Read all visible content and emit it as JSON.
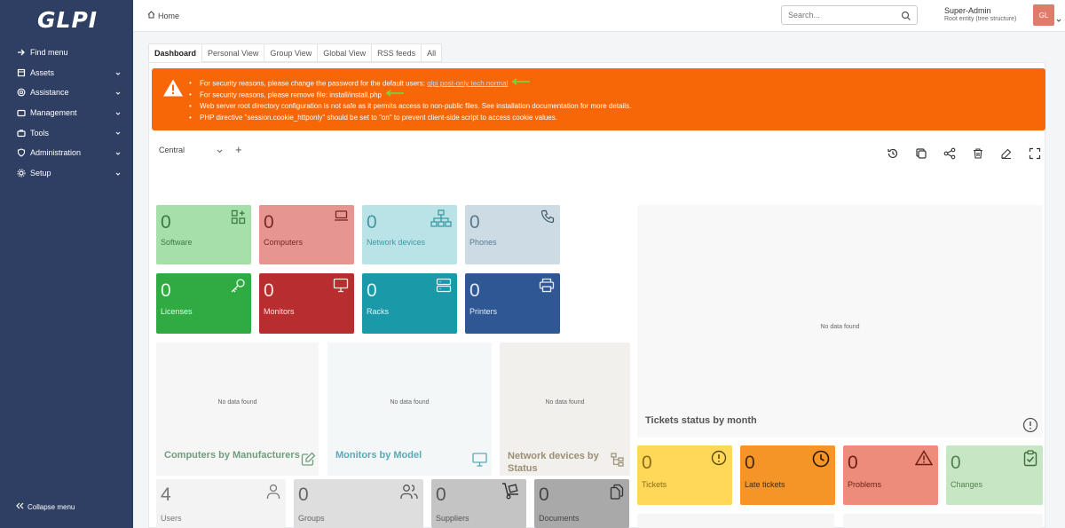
{
  "sidebar": {
    "logo": "GLPI",
    "items": [
      {
        "label": "Find menu",
        "has_chevron": false
      },
      {
        "label": "Assets",
        "has_chevron": true
      },
      {
        "label": "Assistance",
        "has_chevron": true
      },
      {
        "label": "Management",
        "has_chevron": true
      },
      {
        "label": "Tools",
        "has_chevron": true
      },
      {
        "label": "Administration",
        "has_chevron": true
      },
      {
        "label": "Setup",
        "has_chevron": true
      }
    ],
    "collapse_label": "Collapse menu"
  },
  "header": {
    "breadcrumb": "Home",
    "search_placeholder": "Search...",
    "user_name": "Super-Admin",
    "user_entity": "Root entity (tree structure)",
    "avatar_initials": "GL"
  },
  "tabs": [
    "Dashboard",
    "Personal View",
    "Group View",
    "Global View",
    "RSS feeds",
    "All"
  ],
  "active_tab": "Dashboard",
  "alert": {
    "line1_prefix": "For security reasons, please change the password for the default users:",
    "line1_users": "glpi post-only tech normal",
    "line2": "For security reasons, please remove file: install/install.php",
    "line3": "Web server root directory configuration is not safe as it permits access to non-public files. See installation documentation for more details.",
    "line4": "PHP directive \"session.cookie_httponly\" should be set to \"on\" to prevent client-side script to access cookie values."
  },
  "dashboard": {
    "selected": "Central",
    "add_symbol": "+"
  },
  "cards": {
    "software": {
      "value": "0",
      "label": "Software"
    },
    "computers": {
      "value": "0",
      "label": "Computers"
    },
    "network_devices": {
      "value": "0",
      "label": "Network devices"
    },
    "phones": {
      "value": "0",
      "label": "Phones"
    },
    "licenses": {
      "value": "0",
      "label": "Licenses"
    },
    "monitors": {
      "value": "0",
      "label": "Monitors"
    },
    "racks": {
      "value": "0",
      "label": "Racks"
    },
    "printers": {
      "value": "0",
      "label": "Printers"
    },
    "users": {
      "value": "4",
      "label": "Users"
    },
    "groups": {
      "value": "0",
      "label": "Groups"
    },
    "suppliers": {
      "value": "0",
      "label": "Suppliers"
    },
    "documents": {
      "value": "0",
      "label": "Documents"
    },
    "tickets": {
      "value": "0",
      "label": "Tickets"
    },
    "late_tickets": {
      "value": "0",
      "label": "Late tickets"
    },
    "problems": {
      "value": "0",
      "label": "Problems"
    },
    "changes": {
      "value": "0",
      "label": "Changes"
    }
  },
  "widgets": {
    "computers_by_manufacturers": {
      "title": "Computers by Manufacturers",
      "empty": "No data found"
    },
    "monitors_by_model": {
      "title": "Monitors by Model",
      "empty": "No data found"
    },
    "network_devices_by_status": {
      "title": "Network devices by Status",
      "empty": "No data found"
    },
    "tickets_status_by_month": {
      "title": "Tickets status by month",
      "empty": "No data found"
    }
  },
  "colors": {
    "sidebar": "#2f3f64",
    "alert": "#f76707",
    "software": "#a6dfa9",
    "computers": "#e69591",
    "network_devices": "#b9e3e6",
    "phones": "#cddbe4",
    "licenses": "#2fab41",
    "monitors": "#b82e2e",
    "racks": "#1a9aa8",
    "printers": "#2f5793"
  }
}
